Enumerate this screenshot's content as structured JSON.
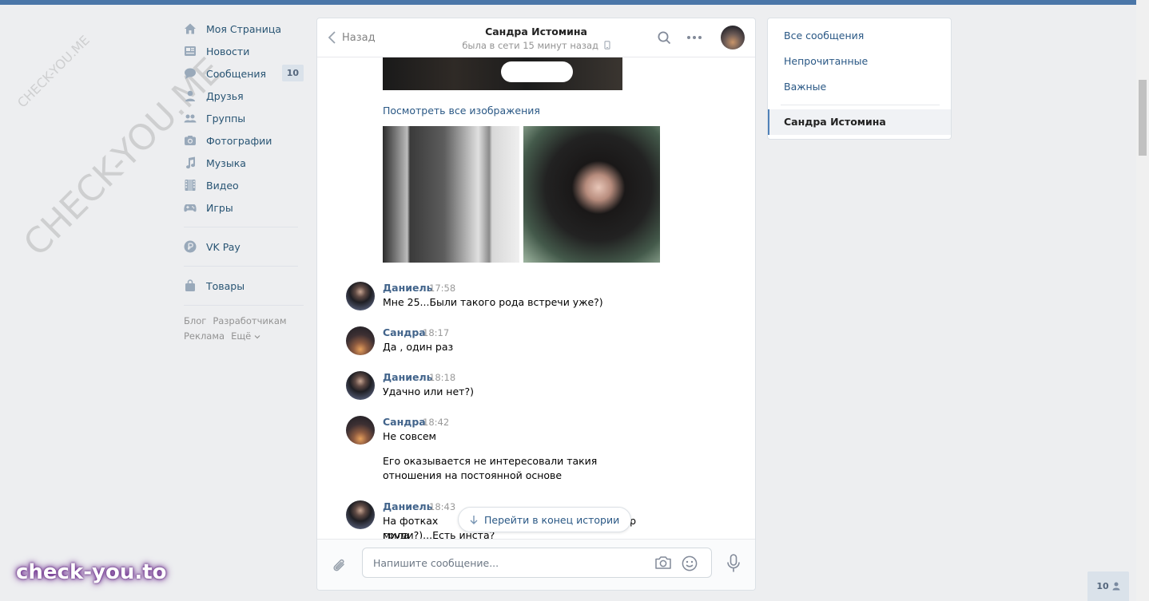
{
  "watermark": {
    "small": "CHECK-YOU.ME",
    "large": "CHECK-YOU.ME",
    "brand": "check-you.to"
  },
  "sidebar": {
    "items": [
      {
        "label": "Моя Страница",
        "icon": "home-icon"
      },
      {
        "label": "Новости",
        "icon": "news-icon"
      },
      {
        "label": "Сообщения",
        "icon": "messages-icon",
        "count": "10"
      },
      {
        "label": "Друзья",
        "icon": "friends-icon"
      },
      {
        "label": "Группы",
        "icon": "groups-icon"
      },
      {
        "label": "Фотографии",
        "icon": "photos-icon"
      },
      {
        "label": "Музыка",
        "icon": "music-icon"
      },
      {
        "label": "Видео",
        "icon": "video-icon"
      },
      {
        "label": "Игры",
        "icon": "games-icon"
      }
    ],
    "vkpay": "VK Pay",
    "goods": "Товары",
    "footer": [
      "Блог",
      "Разработчикам",
      "Реклама",
      "Ещё"
    ]
  },
  "chat": {
    "back_label": "Назад",
    "peer_name": "Сандра Истомина",
    "peer_status": "была в сети 15 минут назад",
    "see_all_images": "Посмотреть все изображения",
    "messages": [
      {
        "author": "Даниель",
        "time": "17:58",
        "text": "Мне 25...Были такого рода встречи уже?)"
      },
      {
        "author": "Сандра",
        "time": "18:17",
        "text": "Да , один раз"
      },
      {
        "author": "Даниель",
        "time": "18:18",
        "text": "Удачно или нет?)"
      },
      {
        "author": "Сандра",
        "time": "18:42",
        "text": "Не совсем",
        "text2": "Его оказывается не интересовали такия отношения на постоянной основе"
      },
      {
        "author": "Даниель",
        "time": "18:43",
        "text_a": "На фотках мила",
        "text_b": "мер",
        "text_c": "груди?)...Есть инста?"
      }
    ],
    "jump_to_end": "Перейти в конец истории",
    "input_placeholder": "Напишите сообщение..."
  },
  "right_panel": {
    "all_messages": "Все сообщения",
    "unread": "Непрочитанные",
    "important": "Важные",
    "active_dialog": "Сандра Истомина"
  },
  "bottom_badge": "10",
  "colors": {
    "accent": "#4a76a8",
    "link": "#2a5885",
    "background": "#edeef0"
  }
}
